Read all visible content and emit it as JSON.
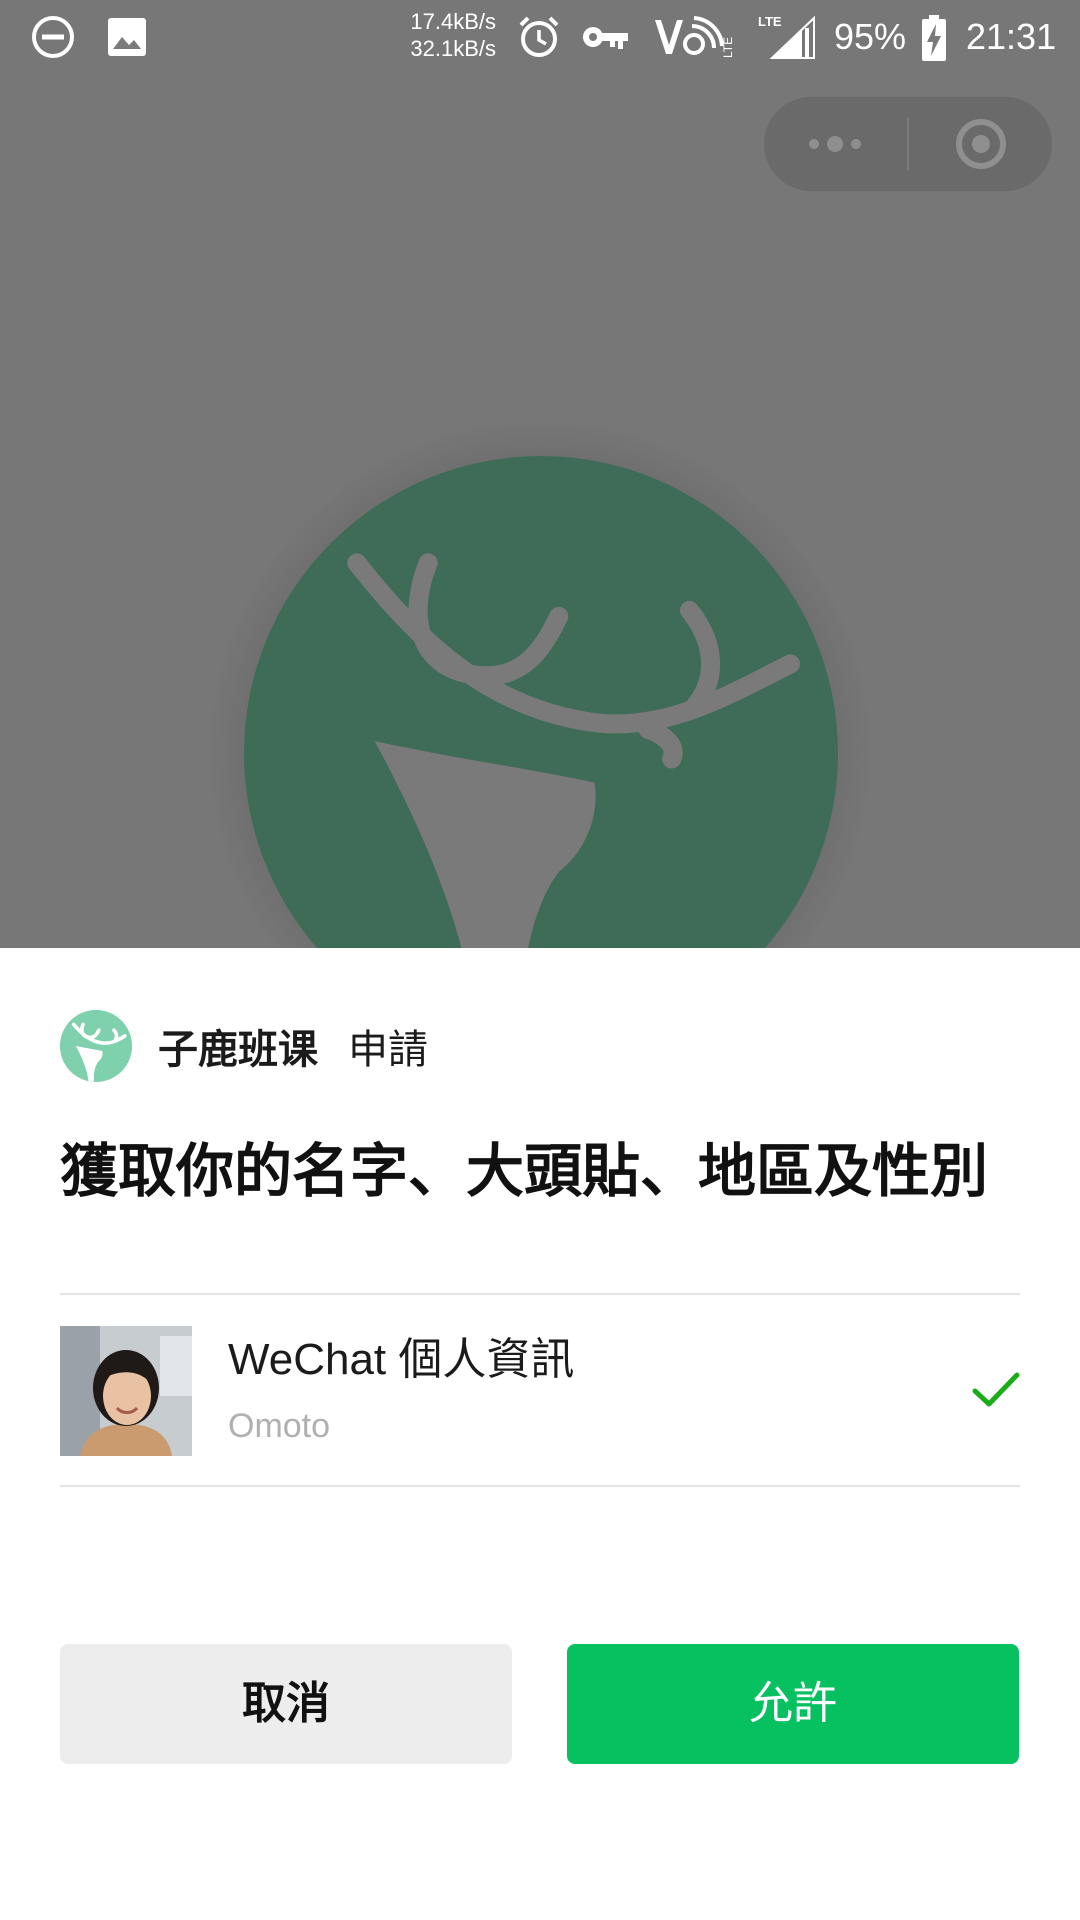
{
  "status_bar": {
    "net_up": "17.4kB/s",
    "net_down": "32.1kB/s",
    "battery": "95%",
    "time": "21:31",
    "icons": [
      "dnd-icon",
      "image-icon",
      "alarm-icon",
      "vpn-key-icon",
      "volte-icon",
      "lte-signal-icon",
      "battery-charging-icon"
    ]
  },
  "capsule": {
    "more_icon": "more-dots-icon",
    "close_icon": "target-close-icon"
  },
  "background": {
    "logo_icon": "deer-antler-logo-icon",
    "logo_color": "#3d6b58"
  },
  "sheet": {
    "app_name": "子鹿班课",
    "request_word": "申請",
    "title": "獲取你的名字、大頭貼、地區及性別",
    "account": {
      "title": "WeChat 個人資訊",
      "name": "Omoto",
      "selected": true
    },
    "cancel_label": "取消",
    "allow_label": "允許"
  },
  "colors": {
    "accent_green": "#07c160",
    "app_icon_bg": "#7fd0ac",
    "check_green": "#1aad19"
  }
}
